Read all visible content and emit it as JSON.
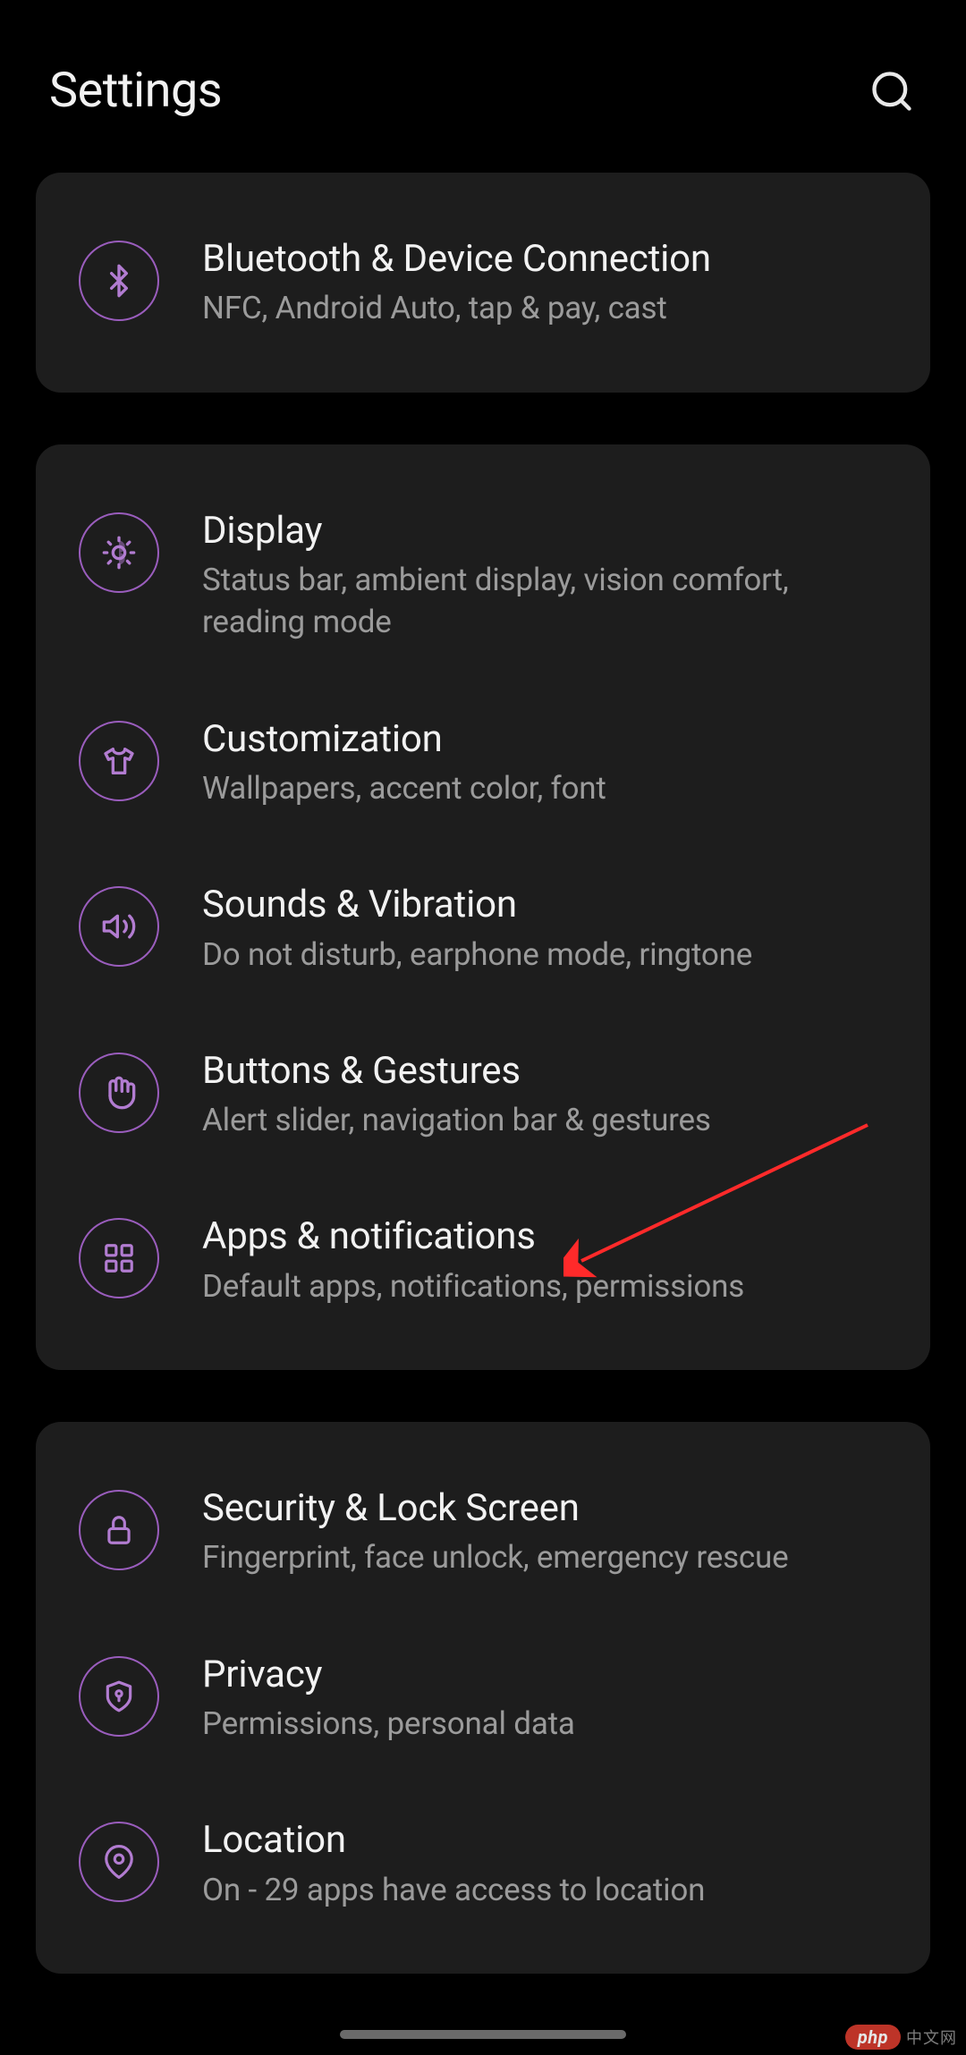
{
  "header": {
    "title": "Settings"
  },
  "groups": [
    {
      "items": [
        {
          "icon": "bluetooth",
          "title": "Bluetooth & Device Connection",
          "subtitle": "NFC, Android Auto, tap & pay, cast"
        }
      ]
    },
    {
      "items": [
        {
          "icon": "display",
          "title": "Display",
          "subtitle": "Status bar, ambient display, vision comfort, reading mode"
        },
        {
          "icon": "customization",
          "title": "Customization",
          "subtitle": "Wallpapers, accent color, font"
        },
        {
          "icon": "sounds",
          "title": "Sounds & Vibration",
          "subtitle": "Do not disturb, earphone mode, ringtone"
        },
        {
          "icon": "buttons",
          "title": "Buttons & Gestures",
          "subtitle": "Alert slider, navigation bar & gestures"
        },
        {
          "icon": "apps",
          "title": "Apps & notifications",
          "subtitle": "Default apps, notifications, permissions"
        }
      ]
    },
    {
      "items": [
        {
          "icon": "security",
          "title": "Security & Lock Screen",
          "subtitle": "Fingerprint, face unlock, emergency rescue"
        },
        {
          "icon": "privacy",
          "title": "Privacy",
          "subtitle": "Permissions, personal data"
        },
        {
          "icon": "location",
          "title": "Location",
          "subtitle": "On - 29 apps have access to location"
        }
      ]
    }
  ],
  "watermark": {
    "brand": "php",
    "text": "中文网"
  },
  "annotation_arrow": {
    "target": "apps-notifications-row"
  }
}
